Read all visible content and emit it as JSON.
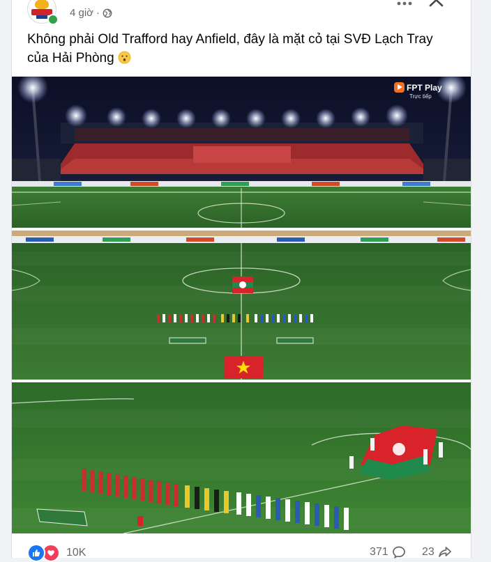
{
  "post": {
    "time": "4 giờ",
    "separator": "·",
    "caption": "Không phải Old Trafford hay Anfield, đây là mặt cỏ tại SVĐ Lạch Tray của Hải Phòng",
    "caption_emoji": "hushed-face-emoji"
  },
  "media": {
    "broadcaster": "FPT Play",
    "broadcast_status": "Trực tiếp"
  },
  "stats": {
    "reactions": "10K",
    "comments": "371",
    "shares": "23"
  },
  "colors": {
    "like_blue": "#1877f2",
    "love_red": "#f33e58",
    "online_green": "#31a24c",
    "pitch_green": "#2f6e2c",
    "flag_red": "#d8232a"
  },
  "icons": {
    "globe": "globe-icon",
    "more": "more-options-icon",
    "close": "close-icon",
    "comment": "comment-icon",
    "share": "share-icon",
    "like": "like-reaction-icon",
    "love": "love-reaction-icon"
  }
}
